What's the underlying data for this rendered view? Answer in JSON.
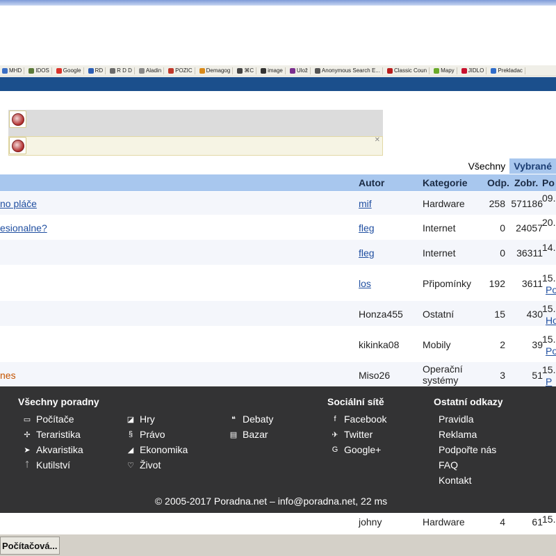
{
  "bookmarks": [
    "MHD",
    "IDOS",
    "Google",
    "RD",
    "R D D",
    "Aladin",
    "POZIC",
    "Demagog",
    "⌘C",
    "image",
    "Ulož",
    "Anonymous Search E...",
    "Classic Coun",
    "Mapy",
    "JIDLO",
    "Prekladac"
  ],
  "filters": {
    "all": "Všechny",
    "selected": "Vybrané"
  },
  "table": {
    "headers": {
      "author": "Autor",
      "category": "Kategorie",
      "replies": "Odp.",
      "views": "Zobr.",
      "last": "Po"
    },
    "rows": [
      {
        "topic": "no pláče",
        "author": "mif",
        "category": "Hardware",
        "replies": "258",
        "views": "571186",
        "last1": "09.",
        "last2": ""
      },
      {
        "topic": "esionalne?",
        "author": "fleg",
        "category": "Internet",
        "replies": "0",
        "views": "24057",
        "last1": "20.",
        "last2": ""
      },
      {
        "topic": "",
        "author": "fleg",
        "category": "Internet",
        "replies": "0",
        "views": "36311",
        "last1": "14.",
        "last2": ""
      },
      {
        "topic": "",
        "author": "los",
        "category": "Připomínky",
        "replies": "192",
        "views": "3611",
        "last1": "15.",
        "last2": "Po"
      },
      {
        "topic": "",
        "author": "Honza455",
        "category": "Ostatní",
        "replies": "15",
        "views": "430",
        "last1": "15.",
        "last2": "Hon"
      },
      {
        "topic": "",
        "author": "kikinka08",
        "category": "Mobily",
        "replies": "2",
        "views": "39",
        "last1": "15.",
        "last2": "Po"
      },
      {
        "topic": "nes",
        "author": "Miso26",
        "category": "Operační systémy",
        "replies": "3",
        "views": "51",
        "last1": "15.",
        "last2": "P"
      },
      {
        "topic": "",
        "author": "johny",
        "category": "Hardware",
        "replies": "4",
        "views": "61",
        "last1": "15.",
        "last2": ""
      }
    ]
  },
  "footer": {
    "col1_title": "Všechny poradny",
    "col1_left": [
      {
        "icon": "computer-icon",
        "label": "Počítače"
      },
      {
        "icon": "lizard-icon",
        "label": "Teraristika"
      },
      {
        "icon": "fish-icon",
        "label": "Akvaristika"
      },
      {
        "icon": "tools-icon",
        "label": "Kutilství"
      }
    ],
    "col1_mid": [
      {
        "icon": "dice-icon",
        "label": "Hry"
      },
      {
        "icon": "paragraph-icon",
        "label": "Právo"
      },
      {
        "icon": "chart-icon",
        "label": "Ekonomika"
      },
      {
        "icon": "heart-icon",
        "label": "Život"
      }
    ],
    "col1_right": [
      {
        "icon": "chat-icon",
        "label": "Debaty"
      },
      {
        "icon": "cart-icon",
        "label": "Bazar"
      }
    ],
    "social_title": "Sociální sítě",
    "social": [
      {
        "icon": "facebook-icon",
        "label": "Facebook"
      },
      {
        "icon": "twitter-icon",
        "label": "Twitter"
      },
      {
        "icon": "google-plus-icon",
        "label": "Google+"
      }
    ],
    "other_title": "Ostatní odkazy",
    "other": [
      "Pravidla",
      "Reklama",
      "Podpořte nás",
      "FAQ",
      "Kontakt"
    ],
    "copyright": "© 2005-2017 Poradna.net – info@poradna.net, 22 ms"
  },
  "taskbar": {
    "button": "Počítačová..."
  },
  "colors": {
    "header_blue": "#a8c7ee",
    "footer_bg": "#333334",
    "link": "#1f4ea0",
    "hot_topic": "#c55400"
  }
}
